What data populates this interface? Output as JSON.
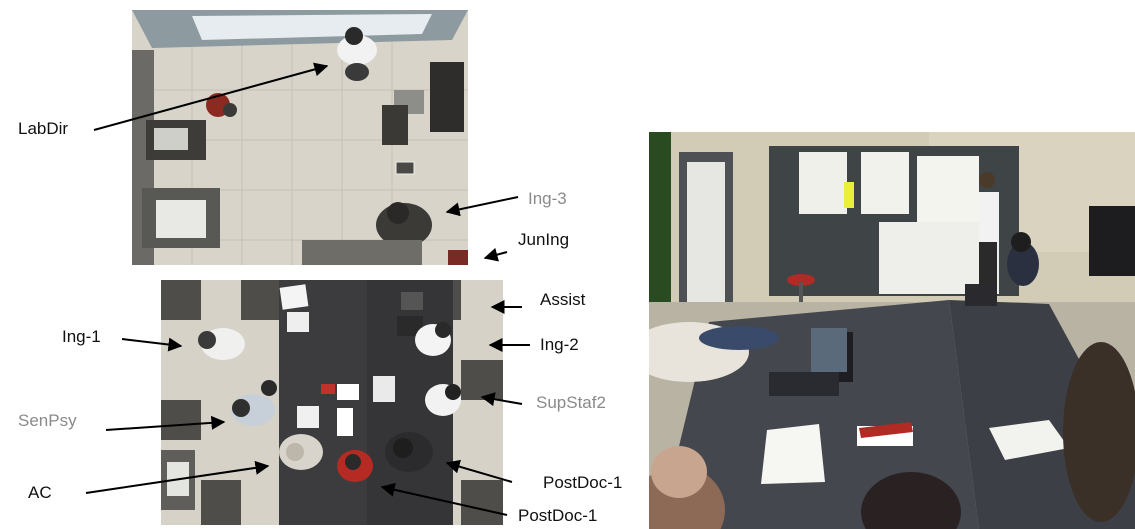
{
  "labels": {
    "labdir": "LabDir",
    "ing3": "Ing-3",
    "juning": "JunIng",
    "assist": "Assist",
    "ing1": "Ing-1",
    "ing2": "Ing-2",
    "senpsy": "SenPsy",
    "supstaf2": "SupStaf2",
    "ac": "AC",
    "postdoc1a": "PostDoc-1",
    "postdoc1b": "PostDoc-1"
  },
  "colors": {
    "label_dark": "#111111",
    "label_gray": "#8a8a8a",
    "arrow": "#000000"
  }
}
